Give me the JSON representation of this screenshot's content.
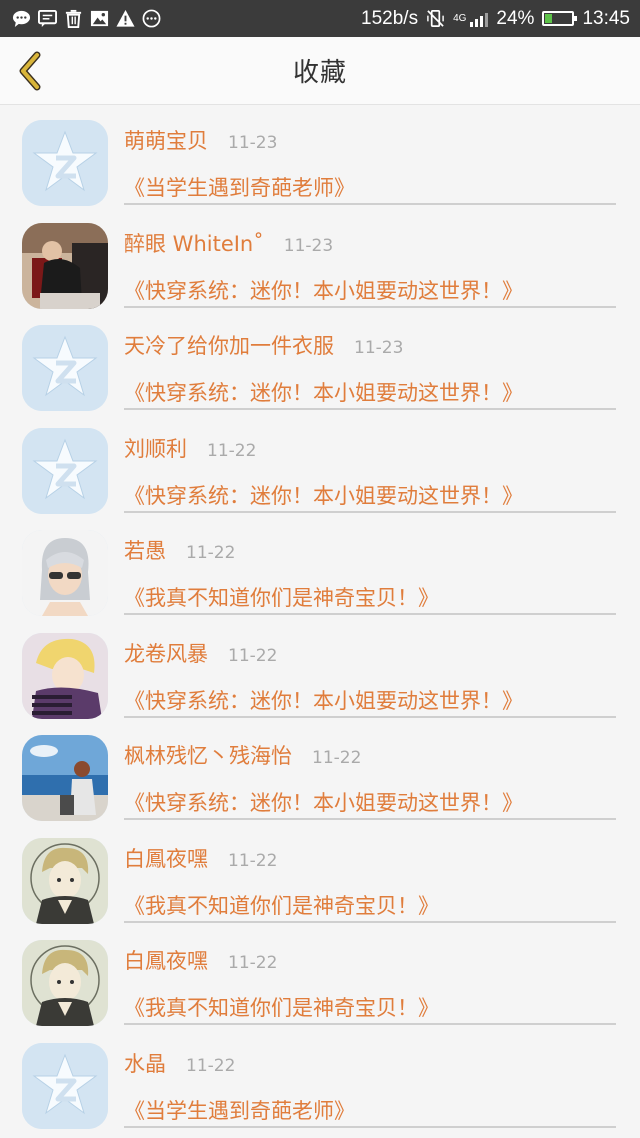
{
  "status_bar": {
    "speed": "152b/s",
    "network": "4G",
    "battery_percent": "24%",
    "battery_level": 0.24,
    "time": "13:45"
  },
  "header": {
    "title": "收藏"
  },
  "colors": {
    "accent": "#e07d3c",
    "back_arrow": "#c9a22a"
  },
  "favorites": [
    {
      "name": "萌萌宝贝",
      "date": "11-23",
      "title": "《当学生遇到奇葩老师》",
      "avatar": "default-qq-icon"
    },
    {
      "name": "醉眼 WhiteIn˚",
      "date": "11-23",
      "title": "《快穿系统：迷你！本小姐要动这世界！》",
      "avatar": "photo-avatar"
    },
    {
      "name": "天冷了给你加一件衣服",
      "date": "11-23",
      "title": "《快穿系统：迷你！本小姐要动这世界！》",
      "avatar": "default-qq-icon"
    },
    {
      "name": "刘顺利",
      "date": "11-22",
      "title": "《快穿系统：迷你！本小姐要动这世界！》",
      "avatar": "default-qq-icon"
    },
    {
      "name": "若愚",
      "date": "11-22",
      "title": "《我真不知道你们是神奇宝贝！》",
      "avatar": "anime-avatar-silver"
    },
    {
      "name": "龙卷风暴",
      "date": "11-22",
      "title": "《快穿系统：迷你！本小姐要动这世界！》",
      "avatar": "anime-avatar-blonde"
    },
    {
      "name": "枫林残忆丶残海怡",
      "date": "11-22",
      "title": "《快穿系统：迷你！本小姐要动这世界！》",
      "avatar": "anime-avatar-seaside"
    },
    {
      "name": "白鳳夜嘿",
      "date": "11-22",
      "title": "《我真不知道你们是神奇宝贝！》",
      "avatar": "anime-avatar-sketch"
    },
    {
      "name": "白鳳夜嘿",
      "date": "11-22",
      "title": "《我真不知道你们是神奇宝贝！》",
      "avatar": "anime-avatar-sketch"
    },
    {
      "name": "水晶",
      "date": "11-22",
      "title": "《当学生遇到奇葩老师》",
      "avatar": "default-qq-icon"
    }
  ]
}
